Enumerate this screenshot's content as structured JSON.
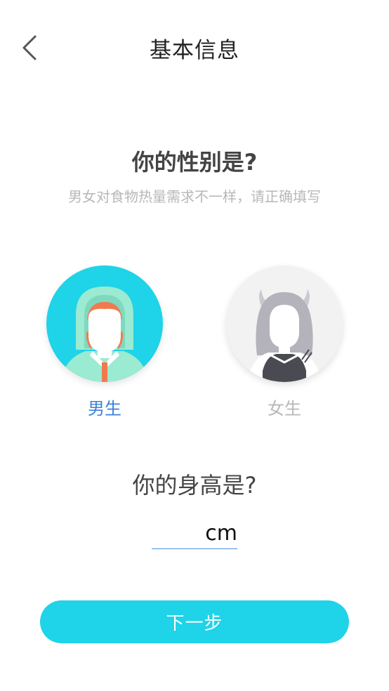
{
  "header": {
    "title": "基本信息",
    "back_icon": "chevron-left-icon"
  },
  "gender": {
    "question": "你的性别是?",
    "hint": "男女对食物热量需求不一样，请正确填写",
    "selected": "male",
    "options": [
      {
        "key": "male",
        "label": "男生",
        "avatar_icon": "male-avatar-icon",
        "color": "#3b82d6"
      },
      {
        "key": "female",
        "label": "女生",
        "avatar_icon": "female-avatar-icon",
        "color": "#b8b8b8"
      }
    ]
  },
  "height": {
    "question": "你的身高是?",
    "value": "",
    "placeholder": "",
    "unit": "cm"
  },
  "footer": {
    "next_label": "下一步"
  },
  "colors": {
    "accent": "#1fd3e8",
    "link_blue": "#3b82d6",
    "muted": "#b8b8b8"
  }
}
